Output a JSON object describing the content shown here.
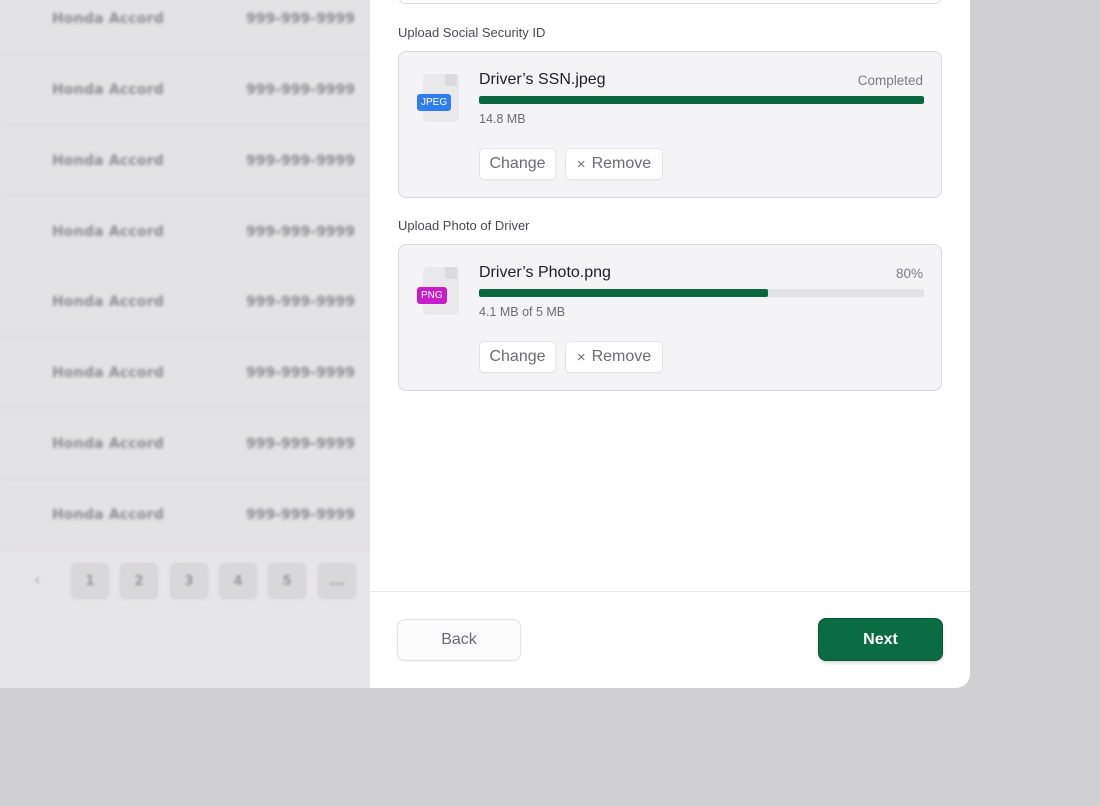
{
  "background_table": {
    "rows": [
      {
        "model": "Honda Accord",
        "phone": "999-999-9999"
      },
      {
        "model": "Honda Accord",
        "phone": "999-999-9999"
      },
      {
        "model": "Honda Accord",
        "phone": "999-999-9999"
      },
      {
        "model": "Honda Accord",
        "phone": "999-999-9999"
      },
      {
        "model": "Honda Accord",
        "phone": "999-999-9999"
      },
      {
        "model": "Honda Accord",
        "phone": "999-999-9999"
      },
      {
        "model": "Honda Accord",
        "phone": "999-999-9999"
      },
      {
        "model": "Honda Accord",
        "phone": "999-999-9999"
      }
    ],
    "pagination": {
      "prev_icon": "‹",
      "pages": [
        "1",
        "2",
        "3",
        "4",
        "5",
        "..."
      ]
    }
  },
  "uploads": [
    {
      "section_label": "Upload Social Security ID",
      "file_type": "JPEG",
      "file_type_color": "#2f7cf0",
      "file_name": "Driver’s SSN.jpeg",
      "status": "Completed",
      "progress": 1.0,
      "size": "14.8 MB",
      "change_label": "Change",
      "remove_label": "Remove"
    },
    {
      "section_label": "Upload Photo of Driver",
      "file_type": "PNG",
      "file_type_color": "#c41fc9",
      "file_name": "Driver’s Photo.png",
      "status": "80%",
      "progress": 0.65,
      "size": "4.1 MB of 5 MB",
      "change_label": "Change",
      "remove_label": "Remove"
    }
  ],
  "footer": {
    "back_label": "Back",
    "next_label": "Next"
  },
  "colors": {
    "accent": "#0b6b42",
    "progress": "#0b6640"
  },
  "icons": {
    "remove": "×"
  }
}
